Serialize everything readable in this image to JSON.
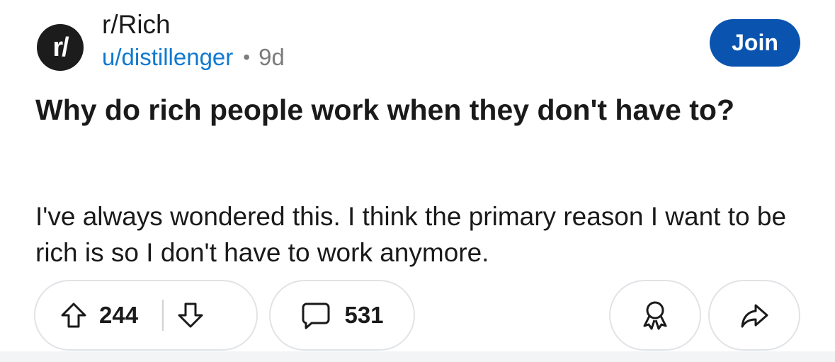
{
  "post": {
    "subreddit_avatar_text": "r/",
    "subreddit": "r/Rich",
    "author": "u/distillenger",
    "separator": "•",
    "age": "9d",
    "join_label": "Join",
    "title": "Why do rich people work when they don't have to?",
    "body": "I've always wondered this. I think the primary reason I want to be rich is so I don't have to work anymore.",
    "upvotes": "244",
    "comments": "531"
  },
  "icons": {
    "upvote": "arrow-up-icon",
    "downvote": "arrow-down-icon",
    "comment": "speech-bubble-icon",
    "award": "award-ribbon-icon",
    "share": "share-arrow-icon"
  },
  "colors": {
    "join_button": "#0a54b0",
    "author_link": "#0f79d0",
    "avatar_bg": "#1c1c1c",
    "muted_text": "#7c7c7c",
    "pill_border": "#e1e3e6"
  }
}
